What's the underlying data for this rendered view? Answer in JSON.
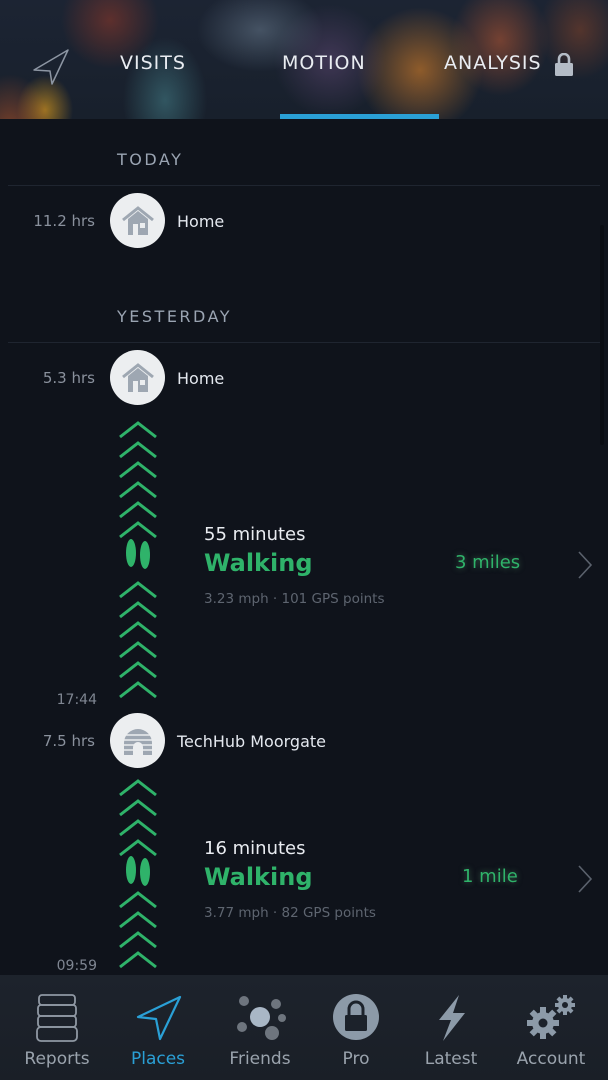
{
  "header": {
    "nav_icon": "location-arrow-icon",
    "tabs": [
      {
        "label": "VISITS",
        "active": false
      },
      {
        "label": "MOTION",
        "active": true
      },
      {
        "label": "ANALYSIS",
        "active": false,
        "locked": true
      }
    ],
    "accent_color": "#2aa0d6"
  },
  "timeline": {
    "sections": [
      {
        "title": "TODAY",
        "items": [
          {
            "type": "visit",
            "duration": "11.2 hrs",
            "place": "Home",
            "icon": "home-icon"
          }
        ]
      },
      {
        "title": "YESTERDAY",
        "items": [
          {
            "type": "visit",
            "duration": "5.3 hrs",
            "place": "Home",
            "icon": "home-icon"
          },
          {
            "type": "activity",
            "duration": "55 minutes",
            "activity": "Walking",
            "meta": "3.23 mph · 101 GPS points",
            "distance": "3 miles",
            "end_time": "17:44"
          },
          {
            "type": "visit",
            "duration": "7.5 hrs",
            "place": "TechHub Moorgate",
            "icon": "igloo-icon"
          },
          {
            "type": "activity",
            "duration": "16 minutes",
            "activity": "Walking",
            "meta": "3.77 mph · 82 GPS points",
            "distance": "1 mile",
            "end_time": "09:59"
          }
        ]
      }
    ],
    "walking_color": "#2fb36a"
  },
  "tabbar": {
    "items": [
      {
        "label": "Reports",
        "icon": "stack-icon",
        "active": false
      },
      {
        "label": "Places",
        "icon": "location-arrow-icon",
        "active": true
      },
      {
        "label": "Friends",
        "icon": "friends-dots-icon",
        "active": false
      },
      {
        "label": "Pro",
        "icon": "lock-icon",
        "active": false
      },
      {
        "label": "Latest",
        "icon": "lightning-icon",
        "active": false
      },
      {
        "label": "Account",
        "icon": "gears-icon",
        "active": false
      }
    ]
  }
}
